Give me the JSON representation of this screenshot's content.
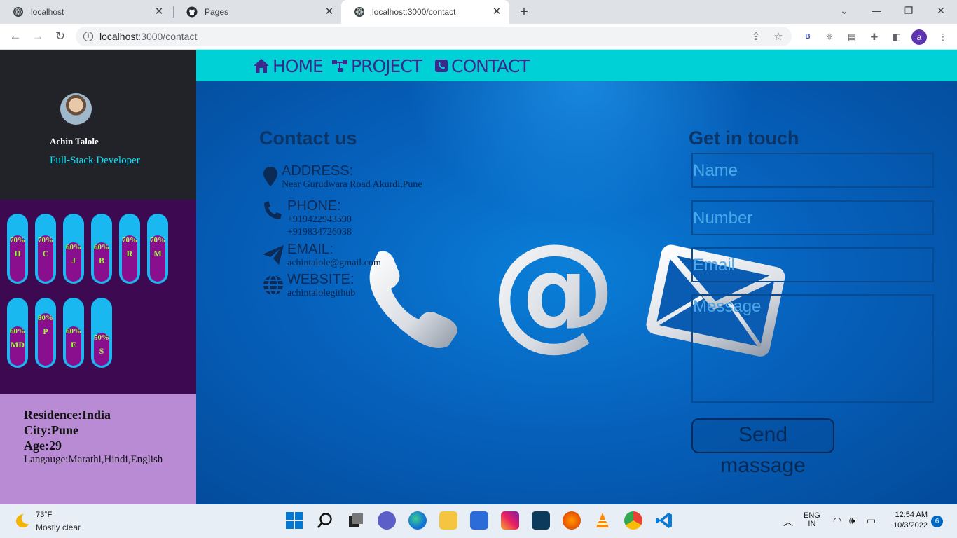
{
  "browser": {
    "tabs": [
      {
        "title": "localhost"
      },
      {
        "title": "Pages"
      },
      {
        "title": "localhost:3000/contact"
      }
    ],
    "address": {
      "url_host": "localhost",
      "url_rest": ":3000/contact"
    }
  },
  "profile": {
    "name": "Achin Talole",
    "role": "Full-Stack Developer",
    "avatar_letter": "a"
  },
  "skills": [
    {
      "pct": "70%",
      "label": "H",
      "level": 0.7
    },
    {
      "pct": "70%",
      "label": "C",
      "level": 0.7
    },
    {
      "pct": "60%",
      "label": "J",
      "level": 0.6
    },
    {
      "pct": "60%",
      "label": "B",
      "level": 0.6
    },
    {
      "pct": "70%",
      "label": "R",
      "level": 0.7
    },
    {
      "pct": "70%",
      "label": "M",
      "level": 0.7
    },
    {
      "pct": "60%",
      "label": "MD",
      "level": 0.6
    },
    {
      "pct": "80%",
      "label": "P",
      "level": 0.8
    },
    {
      "pct": "60%",
      "label": "E",
      "level": 0.6
    },
    {
      "pct": "50%",
      "label": "S",
      "level": 0.5
    }
  ],
  "info": {
    "residence": "Residence:India",
    "city": "City:Pune",
    "age": "Age:29",
    "language": "Langauge:Marathi,Hindi,English"
  },
  "nav": {
    "home": "HOME",
    "project": "PROJECT",
    "contact": "CONTACT"
  },
  "contact": {
    "title": "Contact us",
    "address_label": "ADDRESS:",
    "address_value": "Near Gurudwara Road Akurdi,Pune",
    "phone_label": "PHONE:",
    "phone_1": "+919422943590",
    "phone_2": "+919834726038",
    "email_label": "EMAIL:",
    "email_value": "achintalole@gmail.com",
    "website_label": "WEBSITE:",
    "website_value": "achintalolegithub"
  },
  "form": {
    "title": "Get in touch",
    "name_placeholder": "Name",
    "number_placeholder": "Number",
    "email_placeholder": "Email",
    "message_placeholder": "Message",
    "send_label": "Send massage"
  },
  "taskbar": {
    "temp": "73°F",
    "weather": "Mostly clear",
    "lang_1": "ENG",
    "lang_2": "IN",
    "time": "12:54 AM",
    "date": "10/3/2022",
    "notifications": "6"
  },
  "colors": {
    "nav_bg": "#00d1d6",
    "sidebar_dark": "#222329",
    "skills_bg": "#3d0a52",
    "info_bg": "#b88bd4",
    "hero_blue": "#0662bd"
  }
}
